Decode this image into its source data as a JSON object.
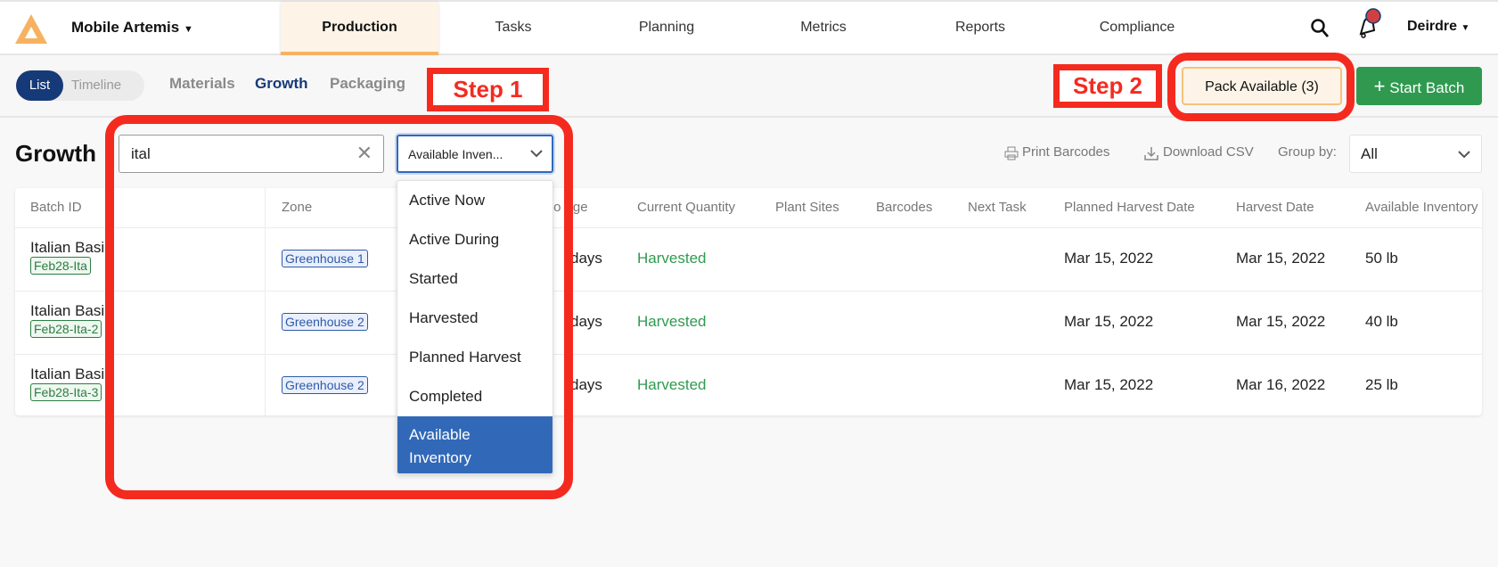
{
  "topnav": {
    "org": "Mobile Artemis",
    "tabs": [
      "Production",
      "Tasks",
      "Planning",
      "Metrics",
      "Reports",
      "Compliance"
    ],
    "active_tab": "Production",
    "user": "Deirdre"
  },
  "subnav": {
    "toggle": [
      "List",
      "Timeline"
    ],
    "links": [
      "Materials",
      "Growth",
      "Packaging"
    ],
    "active_link": "Growth",
    "pack_available": "Pack Available (3)",
    "start_batch": "Start Batch"
  },
  "annotations": {
    "step1": "Step 1",
    "step2": "Step 2"
  },
  "main": {
    "title": "Growth",
    "search_value": "ital",
    "filter_value": "Available Inven...",
    "print_barcodes": "Print Barcodes",
    "download_csv": "Download CSV",
    "group_by_label": "Group by:",
    "group_by_value": "All"
  },
  "dropdown": {
    "options": [
      "Active Now",
      "Active During",
      "Started",
      "Harvested",
      "Planned Harvest",
      "Completed",
      "Available Inventory"
    ],
    "selected": "Available Inventory"
  },
  "table": {
    "headers": [
      "Batch ID",
      "Zone",
      "to Age",
      "Current Quantity",
      "Plant Sites",
      "Barcodes",
      "Next Task",
      "Planned Harvest Date",
      "Harvest Date",
      "Available Inventory"
    ],
    "rows": [
      {
        "name": "Italian Basil",
        "tag": "Feb28-Ita",
        "zone": "Greenhouse 1",
        "age": "days",
        "quantity": "Harvested",
        "planned": "Mar 15, 2022",
        "harvest": "Mar 15, 2022",
        "inventory": "50 lb"
      },
      {
        "name": "Italian Basil",
        "tag": "Feb28-Ita-2",
        "zone": "Greenhouse 2",
        "age": "days",
        "quantity": "Harvested",
        "planned": "Mar 15, 2022",
        "harvest": "Mar 15, 2022",
        "inventory": "40 lb"
      },
      {
        "name": "Italian Basil",
        "tag": "Feb28-Ita-3",
        "zone": "Greenhouse 2",
        "age": "days",
        "quantity": "Harvested",
        "planned": "Mar 15, 2022",
        "harvest": "Mar 16, 2022",
        "inventory": "25 lb"
      }
    ]
  },
  "colors": {
    "accent": "#f6b261",
    "nav_active": "#163a78",
    "green": "#2f9a4f",
    "annotation": "#f52a1f",
    "selected": "#3169b8"
  }
}
